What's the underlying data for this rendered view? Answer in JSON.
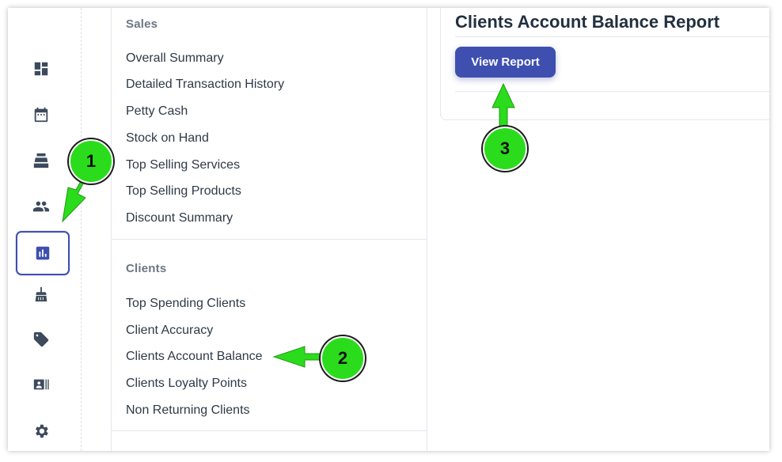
{
  "rail": {
    "items": [
      {
        "icon": "dashboard-icon",
        "active": false
      },
      {
        "icon": "calendar-icon",
        "active": false
      },
      {
        "icon": "cash-register-icon",
        "active": false
      },
      {
        "icon": "people-icon",
        "active": false
      },
      {
        "icon": "bar-chart-icon",
        "active": true
      },
      {
        "icon": "cleaning-brush-icon",
        "active": false
      },
      {
        "icon": "tag-icon",
        "active": false
      },
      {
        "icon": "contact-card-icon",
        "active": false
      },
      {
        "icon": "gear-icon",
        "active": false
      }
    ],
    "accent_color": "#3f4fb0"
  },
  "menu": {
    "sales": {
      "title": "Sales",
      "links": [
        "Overall Summary",
        "Detailed Transaction History",
        "Petty Cash",
        "Stock on Hand",
        "Top Selling Services",
        "Top Selling Products",
        "Discount Summary"
      ]
    },
    "clients": {
      "title": "Clients",
      "links": [
        "Top Spending Clients",
        "Client Accuracy",
        "Clients Account Balance",
        "Clients Loyalty Points",
        "Non Returning Clients"
      ]
    }
  },
  "report": {
    "title": "Clients Account Balance Report",
    "button_label": "View Report"
  },
  "annotations": {
    "color": "#2bdc1c",
    "steps": [
      "1",
      "2",
      "3"
    ]
  }
}
